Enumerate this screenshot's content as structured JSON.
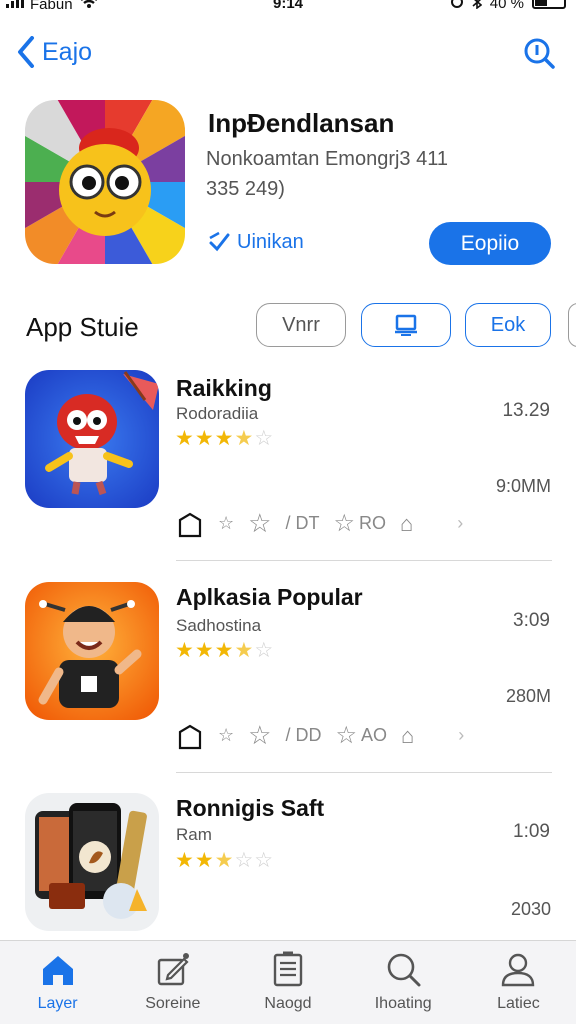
{
  "status_bar": {
    "carrier": "Fabun",
    "time": "9:14",
    "battery": "40 %"
  },
  "nav": {
    "back_label": "Eajo"
  },
  "hero": {
    "title": "InpĐendlansan",
    "subtitle": "Nonkoamtan Emongrj3 4‌11",
    "meta": "335  249)",
    "link_label": "Uinikan",
    "button_label": "Eopiio"
  },
  "section": {
    "title": "App Stuie",
    "filters": [
      "Vnrr",
      "",
      "Eok"
    ]
  },
  "apps": [
    {
      "title": "Raikking",
      "subtitle": "Rodoradiia",
      "rating": 3.5,
      "time": "13.29",
      "size": "9:0ΜM",
      "actions": [
        "",
        "",
        "/ DT",
        "RO",
        "",
        ""
      ]
    },
    {
      "title": "Aplkasia Popular",
      "subtitle": "Sadhostina",
      "rating": 3.5,
      "time": "3:09",
      "size": "280M",
      "actions": [
        "",
        "",
        "/ DD",
        "AO",
        "",
        ""
      ]
    },
    {
      "title": "Ronnigis Saft",
      "subtitle": "Ram",
      "rating": 2.5,
      "time": "1:09",
      "size": "2030",
      "actions": []
    }
  ],
  "tabs": [
    {
      "label": "Layer",
      "icon": "home-icon",
      "active": true
    },
    {
      "label": "Soreine",
      "icon": "edit-icon",
      "active": false
    },
    {
      "label": "Naogd",
      "icon": "document-icon",
      "active": false
    },
    {
      "label": "Ihoating",
      "icon": "search-icon",
      "active": false
    },
    {
      "label": "Latiec",
      "icon": "person-icon",
      "active": false
    }
  ],
  "colors": {
    "accent": "#1a73e8",
    "star": "#f2b705"
  }
}
